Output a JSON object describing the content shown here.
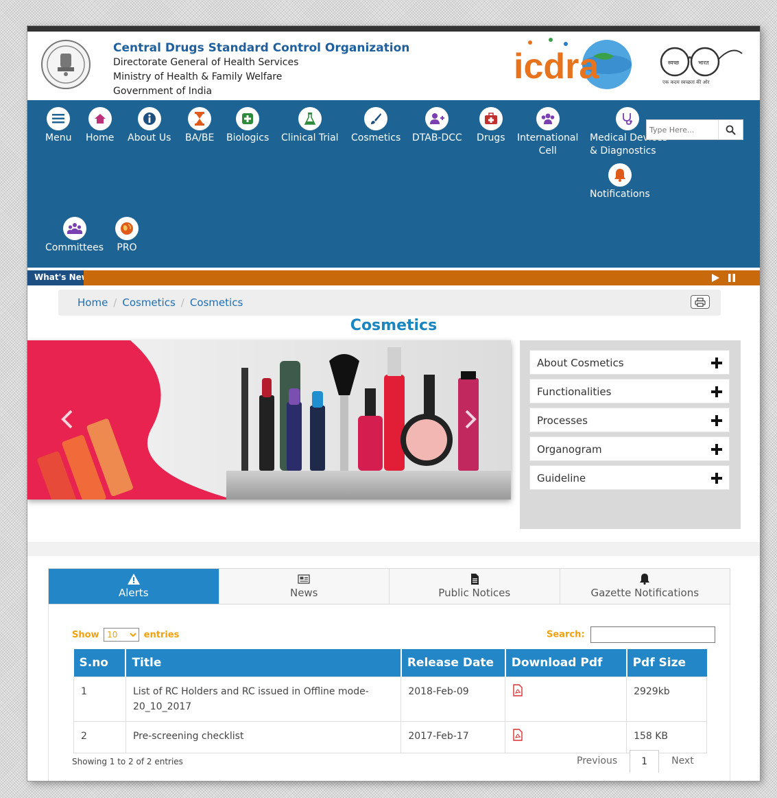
{
  "header": {
    "org_title": "Central Drugs Standard Control Organization",
    "line1": "Directorate General of Health Services",
    "line2": "Ministry of Health & Family Welfare",
    "line3": "Government of India",
    "brand_logo": "icdra",
    "swachh_words": [
      "स्वच्छ",
      "भारत"
    ],
    "swachh_tagline": "एक कदम स्वच्छता की ओर"
  },
  "nav": {
    "items": [
      {
        "label": "Menu",
        "icon": "menu-icon"
      },
      {
        "label": "Home",
        "icon": "home-icon"
      },
      {
        "label": "About Us",
        "icon": "info-icon"
      },
      {
        "label": "BA/BE",
        "icon": "hourglass-icon"
      },
      {
        "label": "Biologics",
        "icon": "plus-square-icon"
      },
      {
        "label": "Clinical Trial",
        "icon": "flask-icon"
      },
      {
        "label": "Cosmetics",
        "icon": "brush-icon"
      },
      {
        "label": "DTAB-DCC",
        "icon": "user-plus-icon"
      },
      {
        "label": "Drugs",
        "icon": "medkit-icon"
      },
      {
        "label": "International",
        "label2": "Cell",
        "icon": "users-icon"
      },
      {
        "label": "Medical Devices",
        "label2": "& Diagnostics",
        "icon": "stethoscope-icon"
      },
      {
        "label": "Notifications",
        "icon": "bell-icon"
      },
      {
        "label": "Committees",
        "icon": "group-icon"
      },
      {
        "label": "PRO",
        "icon": "globe-icon"
      }
    ],
    "search_placeholder": "Type Here..."
  },
  "ticker": {
    "label": "What's New"
  },
  "breadcrumb": [
    "Home",
    "Cosmetics",
    "Cosmetics"
  ],
  "page_title": "Cosmetics",
  "accordion": [
    "About Cosmetics",
    "Functionalities",
    "Processes",
    "Organogram",
    "Guideline"
  ],
  "tabs": [
    {
      "label": "Alerts",
      "icon": "warning-icon",
      "active": true
    },
    {
      "label": "News",
      "icon": "newspaper-icon",
      "active": false
    },
    {
      "label": "Public Notices",
      "icon": "file-icon",
      "active": false
    },
    {
      "label": "Gazette Notifications",
      "icon": "bell-icon",
      "active": false
    }
  ],
  "table": {
    "show_label": "Show",
    "entries_label": "entries",
    "length_value": "10",
    "search_label": "Search:",
    "columns": [
      "S.no",
      "Title",
      "Release Date",
      "Download Pdf",
      "Pdf Size"
    ],
    "rows": [
      {
        "sno": "1",
        "title": "List of RC Holders and RC issued in Offline mode-20_10_2017",
        "date": "2018-Feb-09",
        "size": "2929kb"
      },
      {
        "sno": "2",
        "title": "Pre-screening checklist",
        "date": "2017-Feb-17",
        "size": "158 KB"
      }
    ],
    "info": "Showing 1 to 2 of 2 entries",
    "pager": {
      "previous": "Previous",
      "page": "1",
      "next": "Next"
    }
  },
  "colors": {
    "nav_bg": "#1d6393",
    "accent_blue": "#2386c6",
    "ticker_orange": "#c8690c",
    "title_blue": "#1a86c0",
    "label_orange": "#f0a10d"
  }
}
